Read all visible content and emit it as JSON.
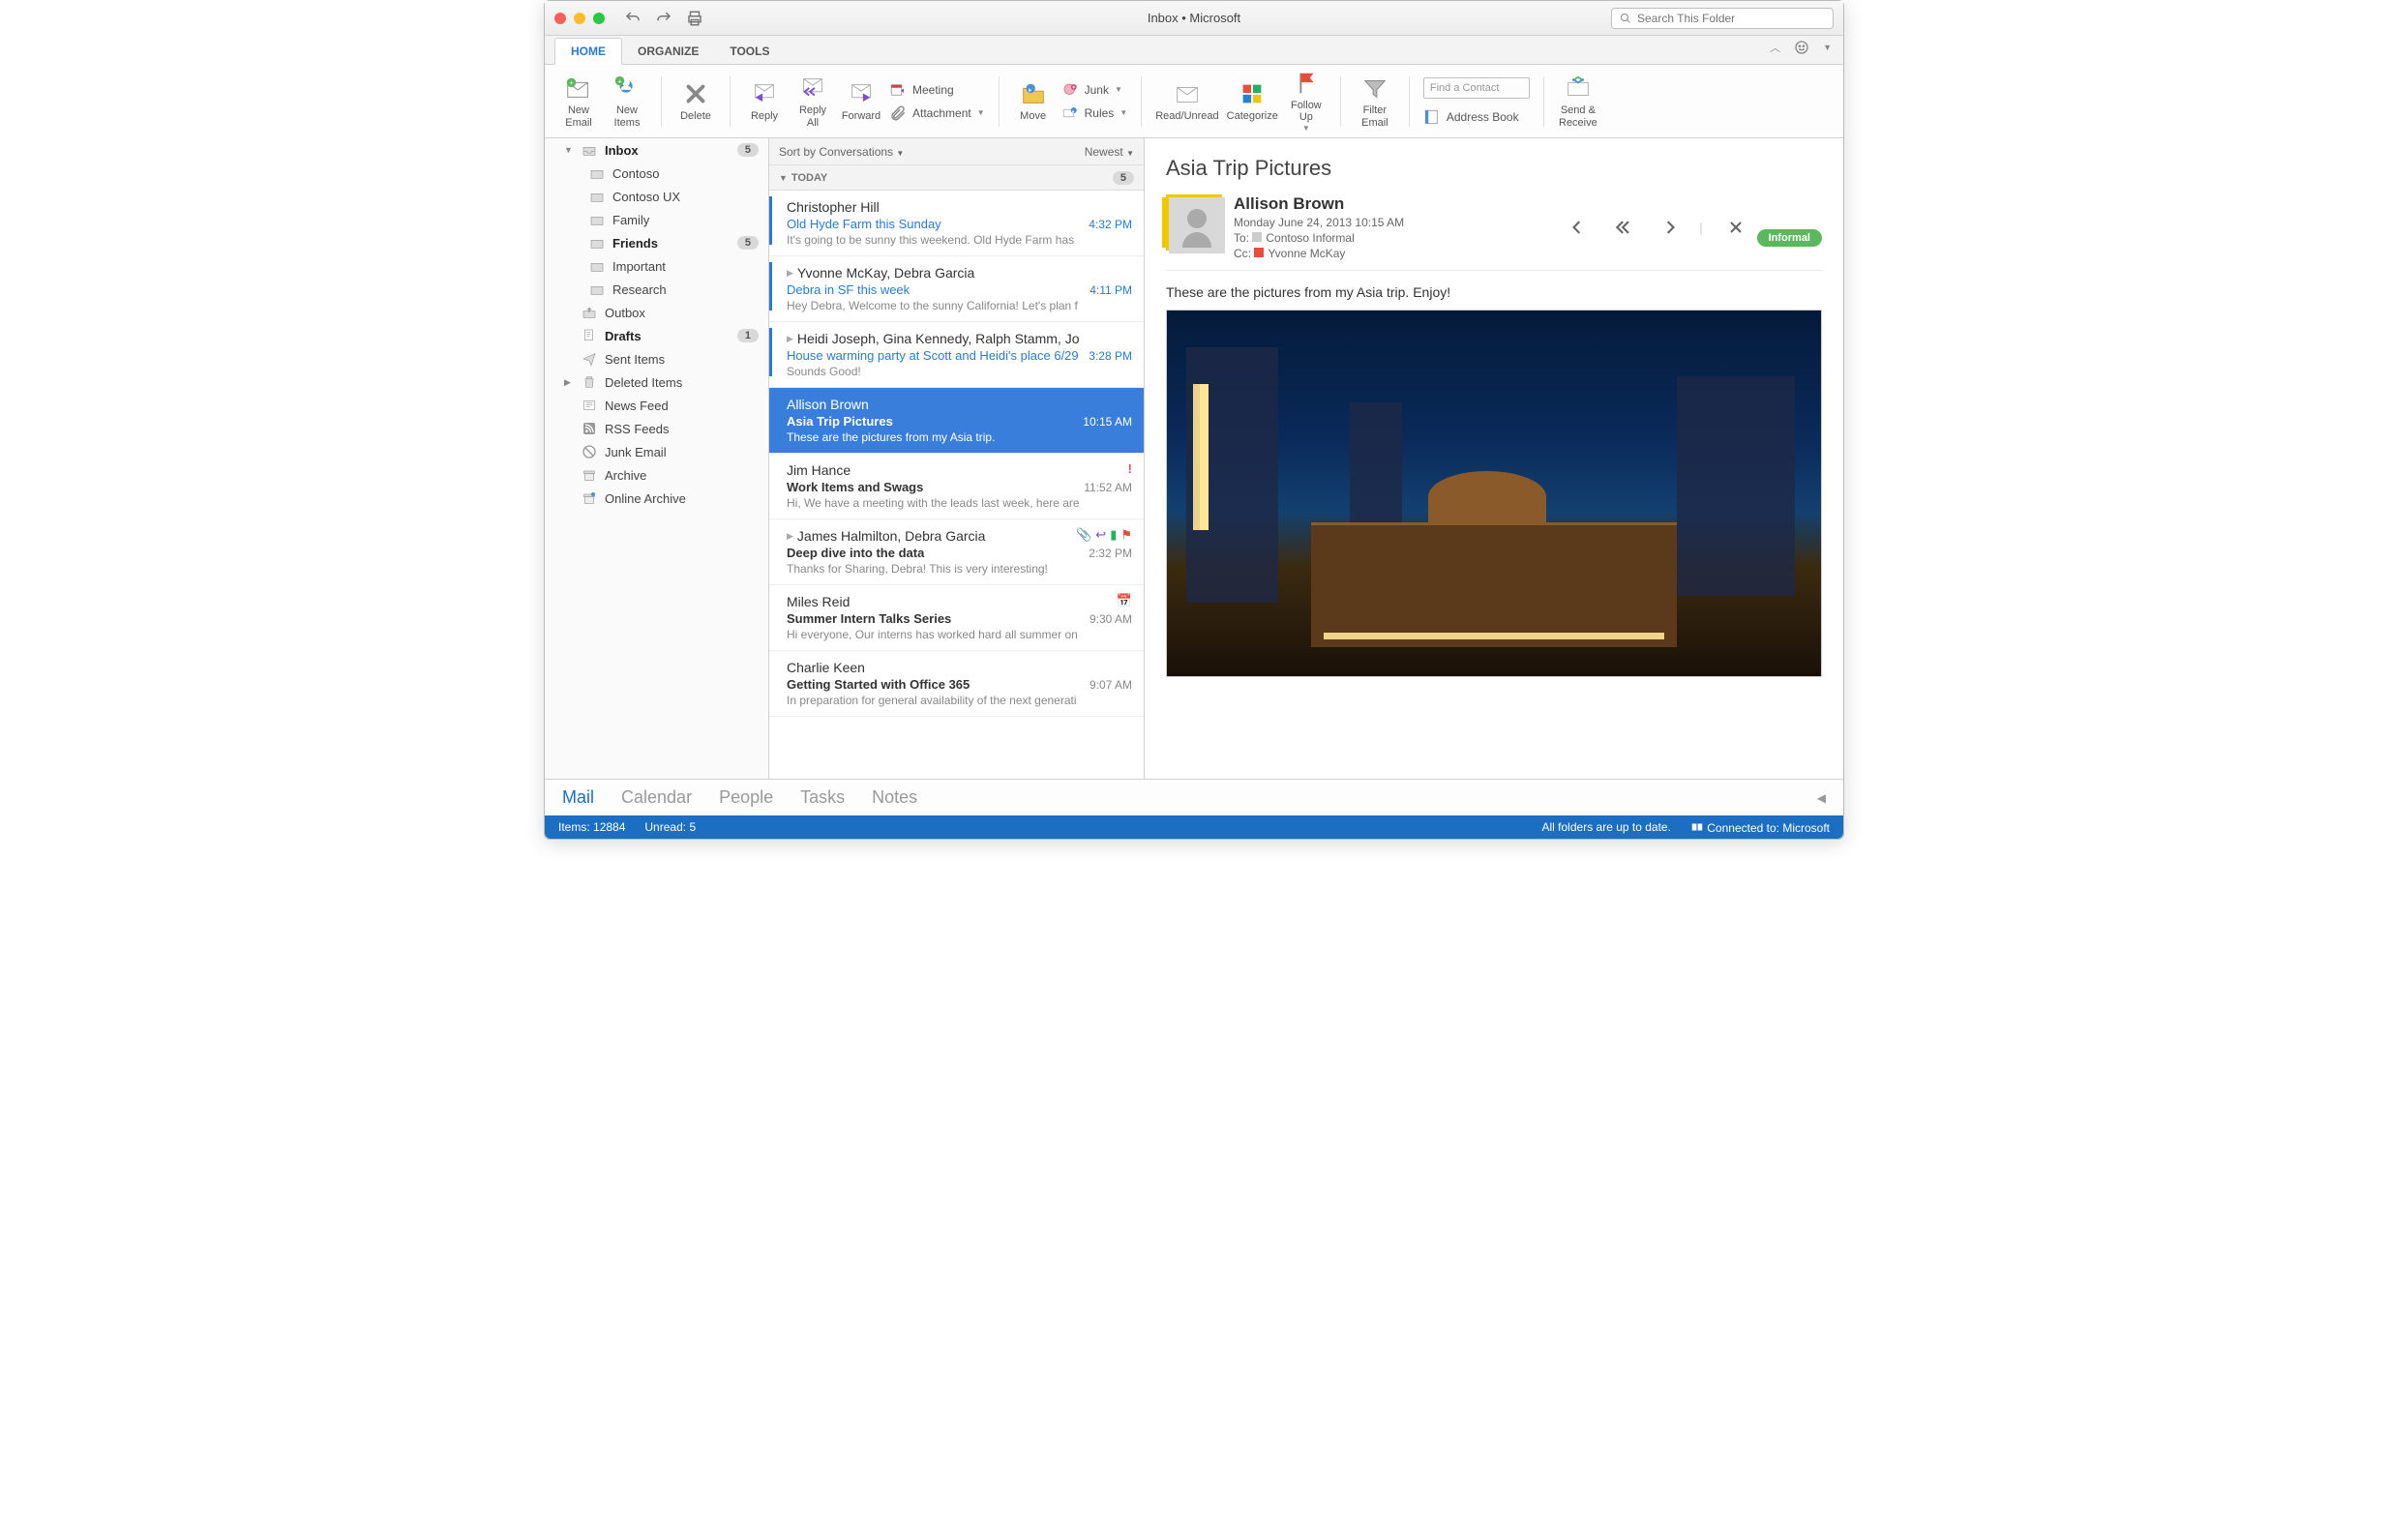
{
  "window": {
    "title": "Inbox • Microsoft",
    "search_placeholder": "Search This Folder"
  },
  "tabs": {
    "home": "HOME",
    "organize": "ORGANIZE",
    "tools": "TOOLS"
  },
  "ribbon": {
    "new_email": "New\nEmail",
    "new_items": "New\nItems",
    "delete": "Delete",
    "reply": "Reply",
    "reply_all": "Reply\nAll",
    "forward": "Forward",
    "meeting": "Meeting",
    "attachment": "Attachment",
    "move": "Move",
    "junk": "Junk",
    "rules": "Rules",
    "read_unread": "Read/Unread",
    "categorize": "Categorize",
    "follow_up": "Follow\nUp",
    "filter_email": "Filter\nEmail",
    "find_contact": "Find a Contact",
    "address_book": "Address Book",
    "send_receive": "Send &\nReceive"
  },
  "sidebar": {
    "inbox": "Inbox",
    "inbox_badge": "5",
    "contoso": "Contoso",
    "contoso_ux": "Contoso UX",
    "family": "Family",
    "friends": "Friends",
    "friends_badge": "5",
    "important": "Important",
    "research": "Research",
    "outbox": "Outbox",
    "drafts": "Drafts",
    "drafts_badge": "1",
    "sent": "Sent Items",
    "deleted": "Deleted Items",
    "news": "News Feed",
    "rss": "RSS Feeds",
    "junk": "Junk Email",
    "archive": "Archive",
    "online_archive": "Online Archive"
  },
  "msglist": {
    "sort_label": "Sort by Conversations",
    "order_label": "Newest",
    "day": "TODAY",
    "day_badge": "5"
  },
  "messages": [
    {
      "from": "Christopher Hill",
      "subject": "Old Hyde Farm this Sunday",
      "preview": "It's going to be sunny this weekend. Old Hyde Farm has",
      "time": "4:32 PM",
      "unread": true
    },
    {
      "from": "Yvonne McKay, Debra Garcia",
      "subject": "Debra in SF this week",
      "preview": "Hey Debra, Welcome to the sunny California! Let's plan f",
      "time": "4:11 PM",
      "unread": true
    },
    {
      "from": "Heidi Joseph, Gina Kennedy, Ralph Stamm, Jo",
      "subject": "House warming party at Scott and Heidi's place 6/29",
      "preview": "Sounds Good!",
      "time": "3:28 PM",
      "unread": true
    },
    {
      "from": "Allison Brown",
      "subject": "Asia Trip Pictures",
      "preview": "These are the pictures from my Asia trip.",
      "time": "10:15 AM"
    },
    {
      "from": "Jim Hance",
      "subject": "Work Items and Swags",
      "preview": "Hi, We have a meeting with the leads last week, here are",
      "time": "11:52 AM"
    },
    {
      "from": "James Halmilton, Debra Garcia",
      "subject": "Deep dive into the data",
      "preview": "Thanks for Sharing, Debra! This is very interesting!",
      "time": "2:32 PM"
    },
    {
      "from": "Miles Reid",
      "subject": "Summer Intern Talks Series",
      "preview": "Hi everyone, Our interns has worked hard all summer on",
      "time": "9:30 AM"
    },
    {
      "from": "Charlie Keen",
      "subject": "Getting Started with Office 365",
      "preview": "In preparation for general availability of the next generati",
      "time": "9:07 AM"
    }
  ],
  "reading": {
    "subject": "Asia Trip Pictures",
    "sender": "Allison Brown",
    "date": "Monday June 24, 2013 10:15 AM",
    "to_label": "To:",
    "to": "Contoso Informal",
    "cc_label": "Cc:",
    "cc": "Yvonne McKay",
    "tag": "Informal",
    "body": "These are the pictures from my Asia trip.   Enjoy!"
  },
  "bottomnav": {
    "mail": "Mail",
    "calendar": "Calendar",
    "people": "People",
    "tasks": "Tasks",
    "notes": "Notes"
  },
  "status": {
    "items_label": "Items:",
    "items": "12884",
    "unread_label": "Unread:",
    "unread": "5",
    "sync": "All folders are up to date.",
    "connected": "Connected to: Microsoft"
  }
}
